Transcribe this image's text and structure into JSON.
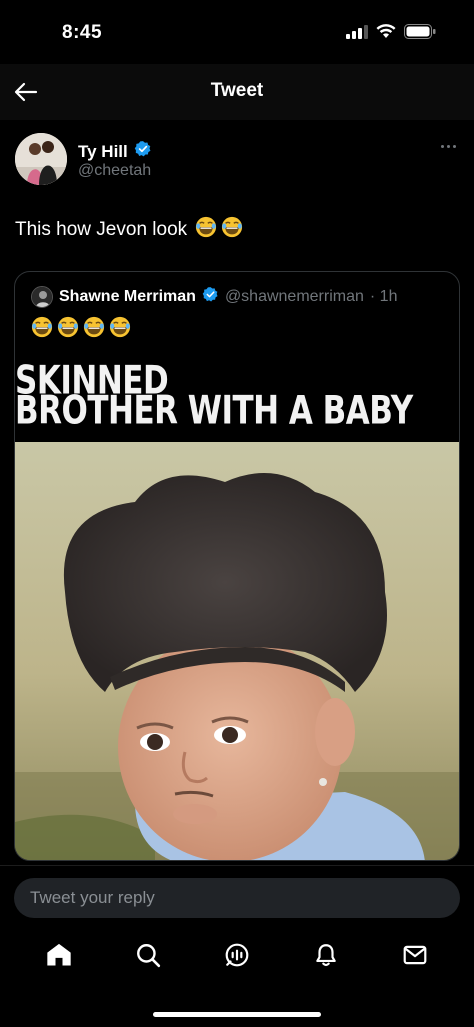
{
  "status_bar": {
    "time": "8:45"
  },
  "header": {
    "title": "Tweet"
  },
  "tweet": {
    "author_name": "Ty Hill",
    "author_handle": "@cheetah",
    "text": "This how Jevon look",
    "emoji": [
      "laughing-face",
      "laughing-face"
    ]
  },
  "quoted_tweet": {
    "author_name": "Shawne Merriman",
    "author_handle": "@shawnemerriman",
    "time": "· 1h",
    "emoji": [
      "laughing-face",
      "laughing-face",
      "laughing-face",
      "laughing-face"
    ],
    "meme_caption": [
      "LADIES LOVE A  LIGHT SKINNED",
      "BROTHER WITH A BABY FACE"
    ]
  },
  "reply": {
    "placeholder": "Tweet your reply"
  },
  "tabs": [
    "home-icon",
    "search-icon",
    "spaces-icon",
    "notifications-icon",
    "messages-icon"
  ],
  "colors": {
    "verified": "#1d9bf0",
    "secondary_text": "#71767b",
    "background": "#000000"
  }
}
